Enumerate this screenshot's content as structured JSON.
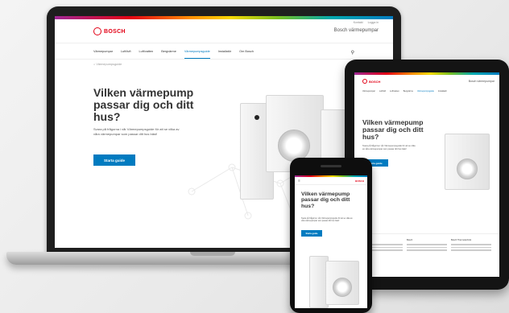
{
  "site": {
    "brand": "BOSCH",
    "title": "Bosch värmepumpar",
    "top_links": [
      "Kontakt",
      "Logga in"
    ],
    "nav": [
      "Värmepumpar",
      "Luft/luft",
      "Luft/vatten",
      "Bergvärme",
      "Värmepumpsguide",
      "Installatör",
      "Om Bosch"
    ],
    "nav_active_index": 4,
    "breadcrumb": "Värmepumpsguide",
    "hero_heading": "Vilken värmepump passar dig och ditt hus?",
    "hero_text": "Svara på frågorna i vår Värmepumpsguide för att se vilka av våra värmepumpar som passar ditt hus bäst!",
    "cta_label": "Starta guide"
  },
  "tablet": {
    "footer_cols": [
      "Bosch",
      "Bosch",
      "Bosch Thermotechnik"
    ]
  },
  "colors": {
    "brand_red": "#e20015",
    "accent_blue": "#007bc0"
  }
}
